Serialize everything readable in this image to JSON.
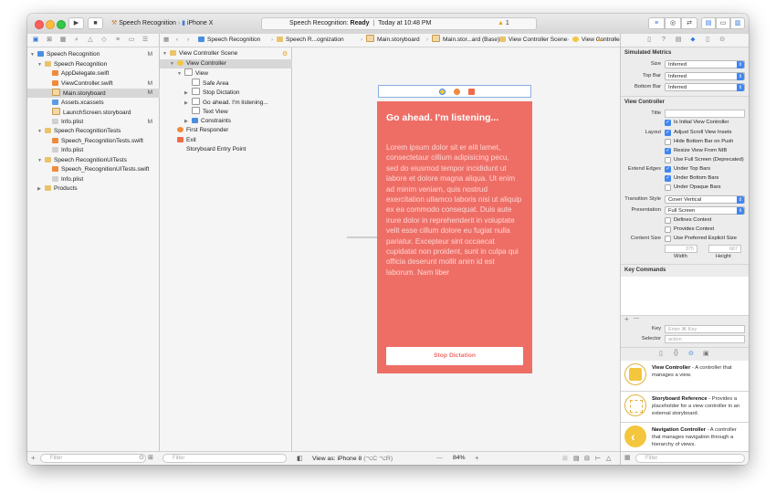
{
  "window": {
    "scheme": {
      "target": "Speech Recognition",
      "device": "iPhone X"
    },
    "status": {
      "text_prefix": "Speech Recognition: ",
      "state": "Ready",
      "time": "Today at 10:48 PM",
      "warnings": "1"
    }
  },
  "navigator": {
    "items": [
      {
        "label": "Speech Recognition",
        "depth": 0,
        "icon": "project-icon",
        "badge": "M",
        "disclosure": "▼"
      },
      {
        "label": "Speech Recognition",
        "depth": 1,
        "icon": "folder-icon",
        "badge": "",
        "disclosure": "▼"
      },
      {
        "label": "AppDelegate.swift",
        "depth": 2,
        "icon": "swift-file-icon",
        "badge": "",
        "disclosure": ""
      },
      {
        "label": "ViewController.swift",
        "depth": 2,
        "icon": "swift-file-icon",
        "badge": "M",
        "disclosure": ""
      },
      {
        "label": "Main.storyboard",
        "depth": 2,
        "icon": "storyboard-file-icon",
        "badge": "M",
        "disclosure": "",
        "selected": true
      },
      {
        "label": "Assets.xcassets",
        "depth": 2,
        "icon": "asset-catalog-icon",
        "badge": "",
        "disclosure": ""
      },
      {
        "label": "LaunchScreen.storyboard",
        "depth": 2,
        "icon": "storyboard-file-icon",
        "badge": "",
        "disclosure": ""
      },
      {
        "label": "Info.plist",
        "depth": 2,
        "icon": "plist-file-icon",
        "badge": "M",
        "disclosure": ""
      },
      {
        "label": "Speech RecognitionTests",
        "depth": 1,
        "icon": "folder-icon",
        "badge": "",
        "disclosure": "▼"
      },
      {
        "label": "Speech_RecognitionTests.swift",
        "depth": 2,
        "icon": "swift-file-icon",
        "badge": "",
        "disclosure": ""
      },
      {
        "label": "Info.plist",
        "depth": 2,
        "icon": "plist-file-icon",
        "badge": "",
        "disclosure": ""
      },
      {
        "label": "Speech RecognitionUITests",
        "depth": 1,
        "icon": "folder-icon",
        "badge": "",
        "disclosure": "▼"
      },
      {
        "label": "Speech_RecognitionUITests.swift",
        "depth": 2,
        "icon": "swift-file-icon",
        "badge": "",
        "disclosure": ""
      },
      {
        "label": "Info.plist",
        "depth": 2,
        "icon": "plist-file-icon",
        "badge": "",
        "disclosure": ""
      },
      {
        "label": "Products",
        "depth": 1,
        "icon": "folder-icon",
        "badge": "",
        "disclosure": "▶"
      }
    ],
    "filter_placeholder": "Filter"
  },
  "jumpbar": {
    "crumbs": [
      "Speech Recognition",
      "Speech R...ognization",
      "Main.storyboard",
      "Main.stor...ard (Base)",
      "View Controller Scene",
      "View Controller"
    ]
  },
  "outline": {
    "items": [
      {
        "label": "View Controller Scene",
        "depth": 0,
        "icon": "scene-icon",
        "disclosure": "▼"
      },
      {
        "label": "View Controller",
        "depth": 1,
        "icon": "view-controller-icon",
        "disclosure": "▼",
        "selected": true
      },
      {
        "label": "View",
        "depth": 2,
        "icon": "view-icon",
        "disclosure": "▼"
      },
      {
        "label": "Safe Area",
        "depth": 3,
        "icon": "safe-area-icon",
        "disclosure": ""
      },
      {
        "label": "Stop Dictation",
        "depth": 3,
        "icon": "button-icon",
        "disclosure": "▶"
      },
      {
        "label": "Go ahead. I'm listening...",
        "depth": 3,
        "icon": "label-icon",
        "disclosure": "▶"
      },
      {
        "label": "Text View",
        "depth": 3,
        "icon": "text-view-icon",
        "disclosure": ""
      },
      {
        "label": "Constraints",
        "depth": 3,
        "icon": "constraints-icon",
        "disclosure": "▶"
      },
      {
        "label": "First Responder",
        "depth": 1,
        "icon": "first-responder-icon",
        "disclosure": ""
      },
      {
        "label": "Exit",
        "depth": 1,
        "icon": "exit-icon",
        "disclosure": ""
      },
      {
        "label": "Storyboard Entry Point",
        "depth": 1,
        "icon": "entry-point-icon",
        "disclosure": ""
      }
    ],
    "filter_placeholder": "Filter"
  },
  "canvas": {
    "title": "Go ahead. I'm listening...",
    "body": "Lorem ipsum dolor sit er elit lamet, consectetaur cillium adipisicing pecu, sed do eiusmod tempor incididunt ut labore et dolore magna aliqua. Ut enim ad minim veniam, quis nostrud exercitation ullamco laboris nisi ut aliquip ex ea commodo consequat. Duis aute irure dolor in reprehenderit in voluptate velit esse cillum dolore eu fugiat nulla pariatur. Excepteur sint occaecat cupidatat non proident, sunt in culpa qui officia deserunt mollit anim id est laborum. Nam liber",
    "button_label": "Stop Dictation",
    "view_as": "View as: iPhone 8",
    "view_as_shortcut": "(⌥C ⌥R)",
    "zoom": "84%",
    "zoom_minus": "—",
    "zoom_plus": "+",
    "scene_color": "#ee6e66"
  },
  "inspector": {
    "simulated_metrics": {
      "header": "Simulated Metrics",
      "size_label": "Size",
      "size_value": "Inferred",
      "topbar_label": "Top Bar",
      "topbar_value": "Inferred",
      "bottombar_label": "Bottom Bar",
      "bottombar_value": "Inferred"
    },
    "view_controller": {
      "header": "View Controller",
      "title_label": "Title",
      "initial_vc": "Is Initial View Controller",
      "layout_label": "Layout",
      "adjust_insets": "Adjust Scroll View Insets",
      "hide_bottom_bar": "Hide Bottom Bar on Push",
      "resize_nib": "Resize View From NIB",
      "full_screen": "Use Full Screen (Deprecated)",
      "extend_label": "Extend Edges",
      "under_top": "Under Top Bars",
      "under_bottom": "Under Bottom Bars",
      "under_opaque": "Under Opaque Bars",
      "transition_label": "Transition Style",
      "transition_value": "Cover Vertical",
      "presentation_label": "Presentation",
      "presentation_value": "Full Screen",
      "defines_context": "Defines Context",
      "provides_context": "Provides Context",
      "content_size_label": "Content Size",
      "preferred_size": "Use Preferred Explicit Size",
      "width_value": "375",
      "height_value": "667",
      "width_label": "Width",
      "height_label": "Height"
    },
    "key_commands": {
      "header": "Key Commands",
      "plus": "+",
      "minus": "—",
      "key_label": "Key",
      "key_placeholder": "Enter ⌘ Key",
      "selector_label": "Selector",
      "selector_placeholder": "action"
    },
    "library": [
      {
        "name": "View Controller",
        "desc": " - A controller that manages a view."
      },
      {
        "name": "Storyboard Reference",
        "desc": " - Provides a placeholder for a view controller in an external storyboard."
      },
      {
        "name": "Navigation Controller",
        "desc": " - A controller that manages navigation through a hierarchy of views."
      }
    ],
    "filter_placeholder": "Filter"
  }
}
